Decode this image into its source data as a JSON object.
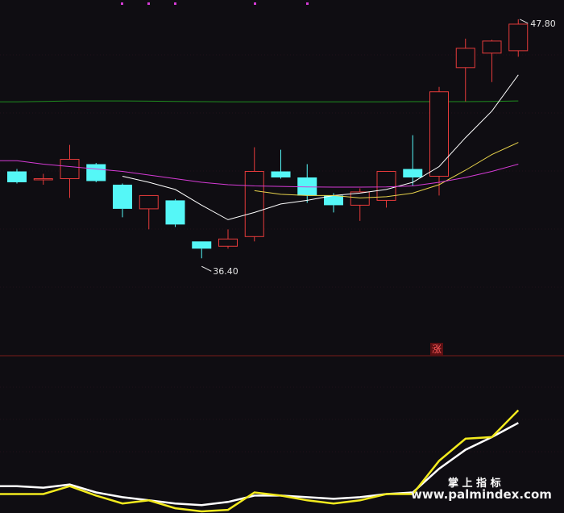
{
  "chart_data": [
    {
      "type": "candlestick",
      "title": "",
      "ylim": [
        34.5,
        48.4
      ],
      "colors": {
        "up": "#e63b3b",
        "down": "#55f7f7",
        "grid": "#7a1b1b",
        "background": "#0f0d12"
      },
      "candles": [
        {
          "o": 41.5,
          "h": 41.6,
          "l": 41.0,
          "c": 41.05
        },
        {
          "o": 41.15,
          "h": 41.4,
          "l": 40.95,
          "c": 41.2
        },
        {
          "o": 41.2,
          "h": 42.6,
          "l": 40.4,
          "c": 42.0
        },
        {
          "o": 41.8,
          "h": 41.85,
          "l": 41.05,
          "c": 41.1
        },
        {
          "o": 40.95,
          "h": 41.0,
          "l": 39.6,
          "c": 39.95
        },
        {
          "o": 39.95,
          "h": 40.5,
          "l": 39.1,
          "c": 40.5
        },
        {
          "o": 40.3,
          "h": 40.35,
          "l": 39.2,
          "c": 39.3
        },
        {
          "o": 38.6,
          "h": 38.6,
          "l": 37.9,
          "c": 38.3
        },
        {
          "o": 38.4,
          "h": 39.1,
          "l": 38.3,
          "c": 38.7
        },
        {
          "o": 38.8,
          "h": 42.5,
          "l": 38.6,
          "c": 41.5
        },
        {
          "o": 41.5,
          "h": 42.4,
          "l": 41.2,
          "c": 41.25
        },
        {
          "o": 41.25,
          "h": 41.8,
          "l": 40.2,
          "c": 40.5
        },
        {
          "o": 40.5,
          "h": 40.6,
          "l": 39.8,
          "c": 40.1
        },
        {
          "o": 40.1,
          "h": 40.8,
          "l": 39.45,
          "c": 40.65
        },
        {
          "o": 40.3,
          "h": 41.5,
          "l": 40.0,
          "c": 41.5
        },
        {
          "o": 41.6,
          "h": 43.0,
          "l": 40.9,
          "c": 41.25
        },
        {
          "o": 41.3,
          "h": 45.0,
          "l": 40.5,
          "c": 44.8
        },
        {
          "o": 45.8,
          "h": 47.0,
          "l": 44.4,
          "c": 46.6
        },
        {
          "o": 46.4,
          "h": 46.95,
          "l": 45.2,
          "c": 46.9
        },
        {
          "o": 46.5,
          "h": 47.8,
          "l": 46.25,
          "c": 47.6
        }
      ],
      "moving_averages": [
        {
          "color": "#ffffff",
          "values": [
            null,
            null,
            null,
            null,
            41.3,
            41.05,
            40.75,
            40.1,
            39.5,
            39.8,
            40.15,
            40.3,
            40.5,
            40.6,
            40.75,
            41.05,
            41.7,
            42.9,
            44.0,
            45.5
          ]
        },
        {
          "color": "#e7d24b",
          "values": [
            null,
            null,
            null,
            null,
            null,
            null,
            null,
            null,
            null,
            40.7,
            40.55,
            40.5,
            40.5,
            40.4,
            40.45,
            40.6,
            40.95,
            41.55,
            42.2,
            42.7
          ]
        },
        {
          "color": "#d63bd6",
          "values": [
            41.94,
            41.8,
            41.7,
            41.6,
            41.5,
            41.35,
            41.2,
            41.05,
            40.95,
            40.9,
            40.88,
            40.86,
            40.85,
            40.85,
            40.86,
            40.9,
            41.05,
            41.25,
            41.5,
            41.8
          ]
        }
      ],
      "long_ma": {
        "color": "#1f8f1f",
        "values": [
          44.38,
          44.4,
          44.42,
          44.42,
          44.42,
          44.41,
          44.4,
          44.39,
          44.38,
          44.38,
          44.38,
          44.38,
          44.38,
          44.38,
          44.38,
          44.39,
          44.39,
          44.39,
          44.4,
          44.42
        ]
      },
      "annotations": [
        {
          "text": "47.80",
          "index": 19,
          "value": 47.8
        },
        {
          "text": "36.40",
          "index": 7,
          "value": 37.9
        }
      ],
      "marker_text": "涨"
    },
    {
      "type": "line",
      "title": "",
      "ylim": [
        0,
        100
      ],
      "series": [
        {
          "color": "#ffffff",
          "values": [
            17,
            16,
            18,
            13,
            10,
            8,
            6,
            5,
            7,
            11,
            11,
            10,
            9,
            10,
            12,
            13,
            28,
            40,
            48,
            57
          ]
        },
        {
          "color": "#f2ea1e",
          "values": [
            12,
            12,
            17,
            11,
            6,
            8,
            3,
            1,
            2,
            13,
            11,
            8,
            6,
            8,
            12,
            12,
            33,
            47,
            48,
            65
          ]
        }
      ]
    }
  ],
  "watermark": {
    "top": "掌 上 指 标",
    "bottom": "www.palmindex.com"
  }
}
